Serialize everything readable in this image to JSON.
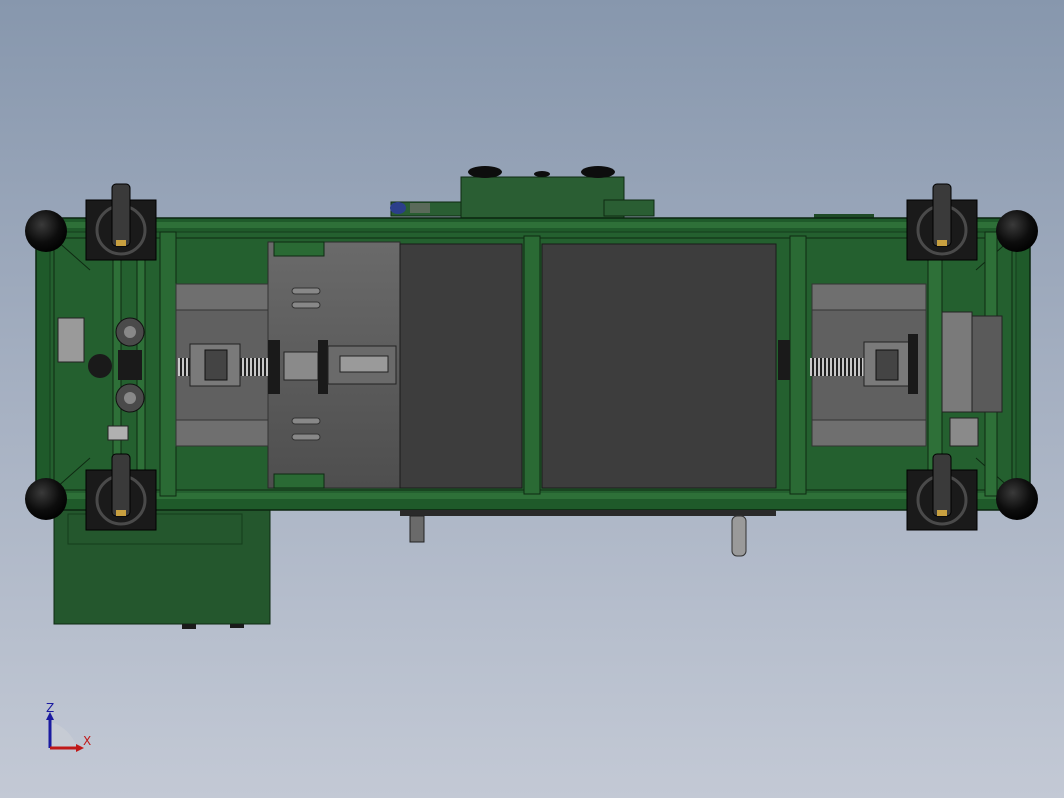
{
  "viewport": {
    "name": "cad-3d-viewport",
    "background_top": "#8797ad",
    "background_bottom": "#c3c9d5"
  },
  "model": {
    "frame_color": "#1f5a2a",
    "frame_dark": "#143d1c",
    "panel_dark": "#3d3d3d",
    "plate_gray": "#5a5a5a",
    "wheel_color": "#0d0d0d"
  },
  "triad": {
    "z_label": "Z",
    "x_label": "X",
    "z_color": "#1a1aa0",
    "x_color": "#c01818"
  }
}
